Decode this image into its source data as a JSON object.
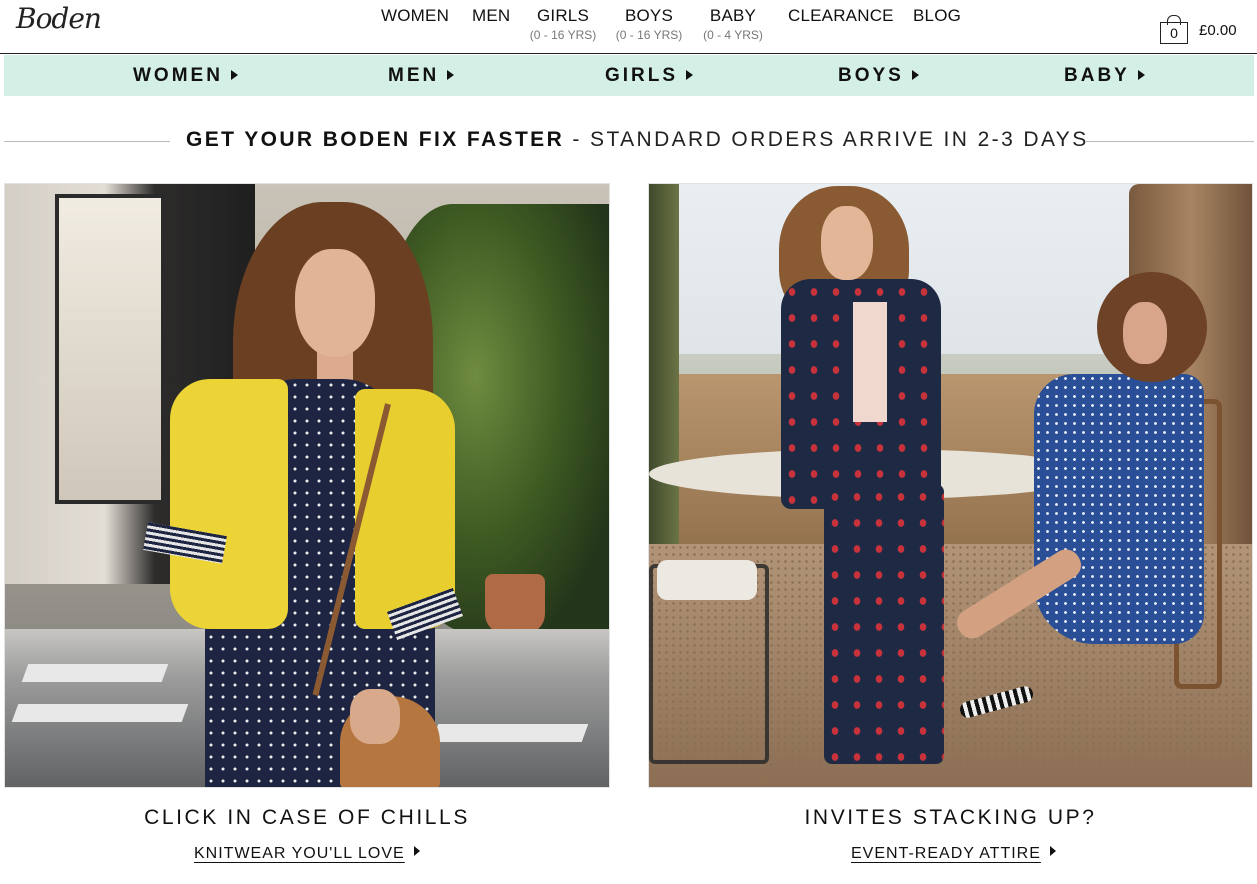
{
  "brand": {
    "logo_text": "Boden"
  },
  "top_nav": {
    "women": "WOMEN",
    "men": "MEN",
    "girls": "GIRLS",
    "girls_sub": "(0 - 16 YRS)",
    "boys": "BOYS",
    "boys_sub": "(0 - 16 YRS)",
    "baby": "BABY",
    "baby_sub": "(0 - 4 YRS)",
    "clearance": "CLEARANCE",
    "blog": "BLOG"
  },
  "bag": {
    "count": "0",
    "total": "£0.00"
  },
  "category_bar": {
    "women": "WOMEN",
    "men": "MEN",
    "girls": "GIRLS",
    "boys": "BOYS",
    "baby": "BABY"
  },
  "promo": {
    "strong": "GET YOUR BODEN FIX FASTER",
    "rest": "- STANDARD ORDERS ARRIVE IN 2-3 DAYS"
  },
  "panels": {
    "left": {
      "title": "CLICK IN CASE OF CHILLS",
      "link": "KNITWEAR YOU'LL LOVE"
    },
    "right": {
      "title": "INVITES STACKING UP?",
      "link": "EVENT-READY ATTIRE"
    }
  },
  "icons": {
    "bag": "shopping-bag-icon",
    "arrow": "triangle-right-icon"
  },
  "colors": {
    "category_bar_bg": "#d3efe6",
    "text": "#111111"
  }
}
